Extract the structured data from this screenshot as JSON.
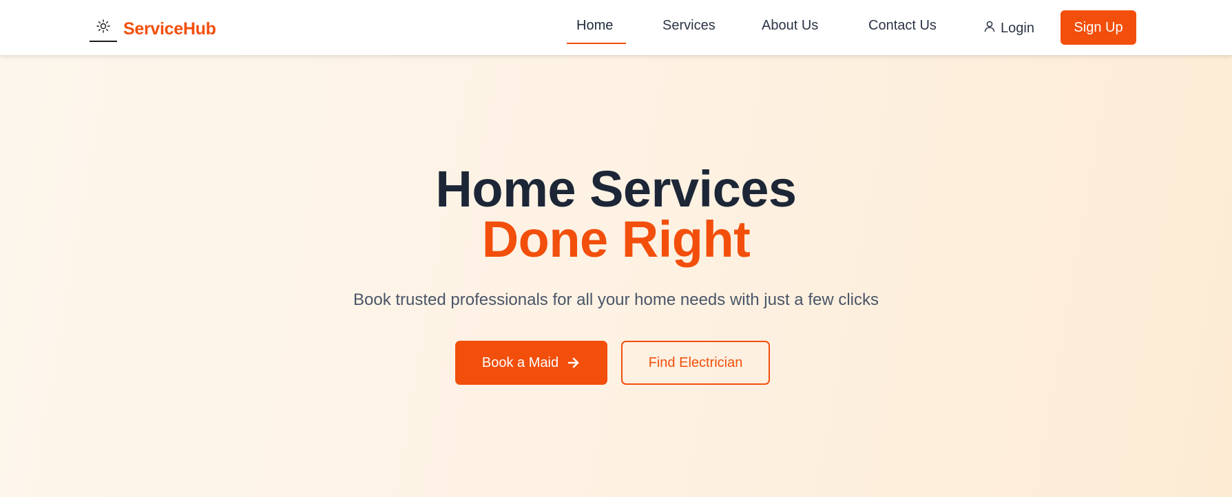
{
  "brand": {
    "name": "ServiceHub",
    "accent_color": "#f24f0c",
    "logo_icon": "sun-icon"
  },
  "nav": {
    "links": [
      {
        "label": "Home",
        "active": true
      },
      {
        "label": "Services",
        "active": false
      },
      {
        "label": "About Us",
        "active": false
      },
      {
        "label": "Contact Us",
        "active": false
      }
    ],
    "login": {
      "label": "Login",
      "icon": "user-icon"
    },
    "signup_label": "Sign Up"
  },
  "hero": {
    "title_line1": "Home Services",
    "title_line2": "Done Right",
    "subtitle": "Book trusted professionals for all your home needs with just a few clicks",
    "primary_cta": {
      "label": "Book a Maid",
      "icon": "arrow-right-icon"
    },
    "secondary_cta": {
      "label": "Find Electrician"
    }
  },
  "colors": {
    "accent": "#f24f0c",
    "heading": "#1c2636",
    "body_text": "#4a5568",
    "hero_background": "#fdf1e2"
  }
}
